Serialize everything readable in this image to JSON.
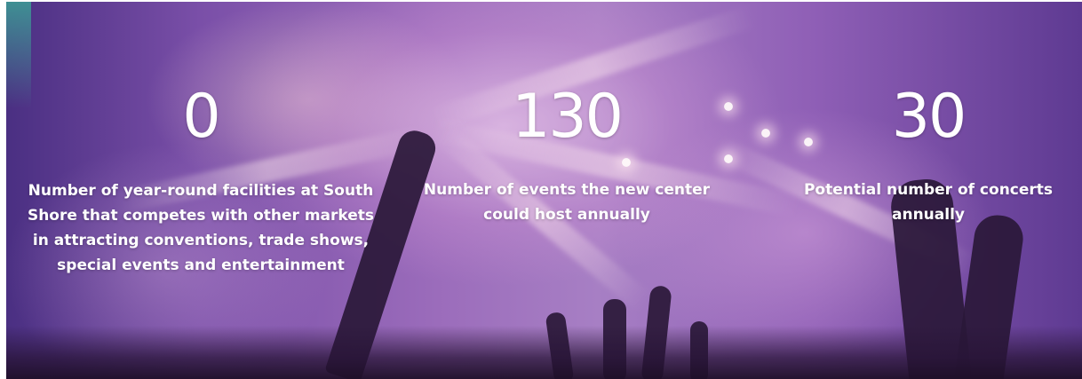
{
  "stats": [
    {
      "value": "0",
      "caption": "Number of year-round facilities at South Shore that competes with other markets in attracting conventions, trade shows, special events and entertainment"
    },
    {
      "value": "130",
      "caption": "Number of events the new center could host annually"
    },
    {
      "value": "30",
      "caption": "Potential number of concerts annually"
    }
  ]
}
